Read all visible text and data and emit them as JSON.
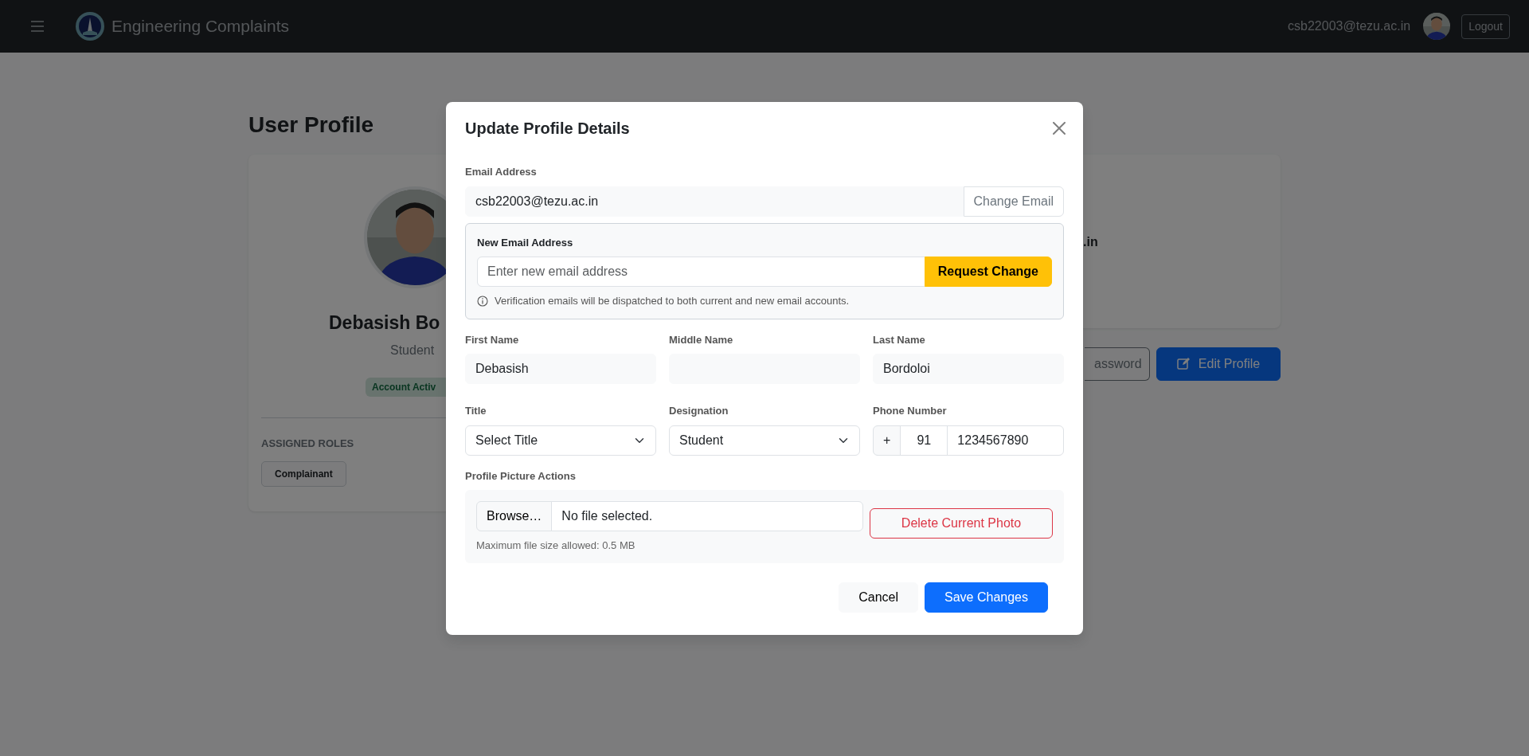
{
  "navbar": {
    "brand": "Engineering Complaints",
    "user_email": "csb22003@tezu.ac.in",
    "logout": "Logout"
  },
  "page": {
    "heading": "User Profile",
    "profile_card": {
      "name": "Debasish Bo",
      "role": "Student",
      "status_badge": "Account Activ",
      "roles_heading": "ASSIGNED ROLES",
      "roles": [
        "Complainant"
      ]
    },
    "details_card": {
      "value_fragment": ".in"
    },
    "buttons": [
      {
        "label": "assword"
      },
      {
        "label": "Edit Profile"
      }
    ]
  },
  "modal": {
    "title": "Update Profile Details",
    "email": {
      "label": "Email Address",
      "value": "csb22003@tezu.ac.in",
      "button": "Change Email"
    },
    "new_email": {
      "label": "New Email Address",
      "placeholder": "Enter new email address",
      "button": "Request Change",
      "note": "Verification emails will be dispatched to both current and new email accounts."
    },
    "fields": [
      {
        "kind": "text",
        "label": "First Name",
        "value": "Debasish"
      },
      {
        "kind": "text",
        "label": "Middle Name"
      },
      {
        "kind": "text",
        "label": "Last Name",
        "value": "Bordoloi"
      },
      {
        "kind": "select",
        "label": "Title",
        "value": "Select Title"
      },
      {
        "kind": "select",
        "label": "Designation",
        "value": "Student"
      },
      {
        "kind": "phone",
        "label": "Phone Number",
        "prefix": "+",
        "country_code": "91",
        "value": "1234567890"
      }
    ],
    "picture_actions": {
      "label": "Profile Picture Actions",
      "browse": "Browse…",
      "file_status": "No file selected.",
      "hint": "Maximum file size allowed: 0.5 MB",
      "delete_button": "Delete Current Photo"
    },
    "footer": [
      {
        "label": "Cancel"
      },
      {
        "label": "Save Changes"
      }
    ]
  }
}
